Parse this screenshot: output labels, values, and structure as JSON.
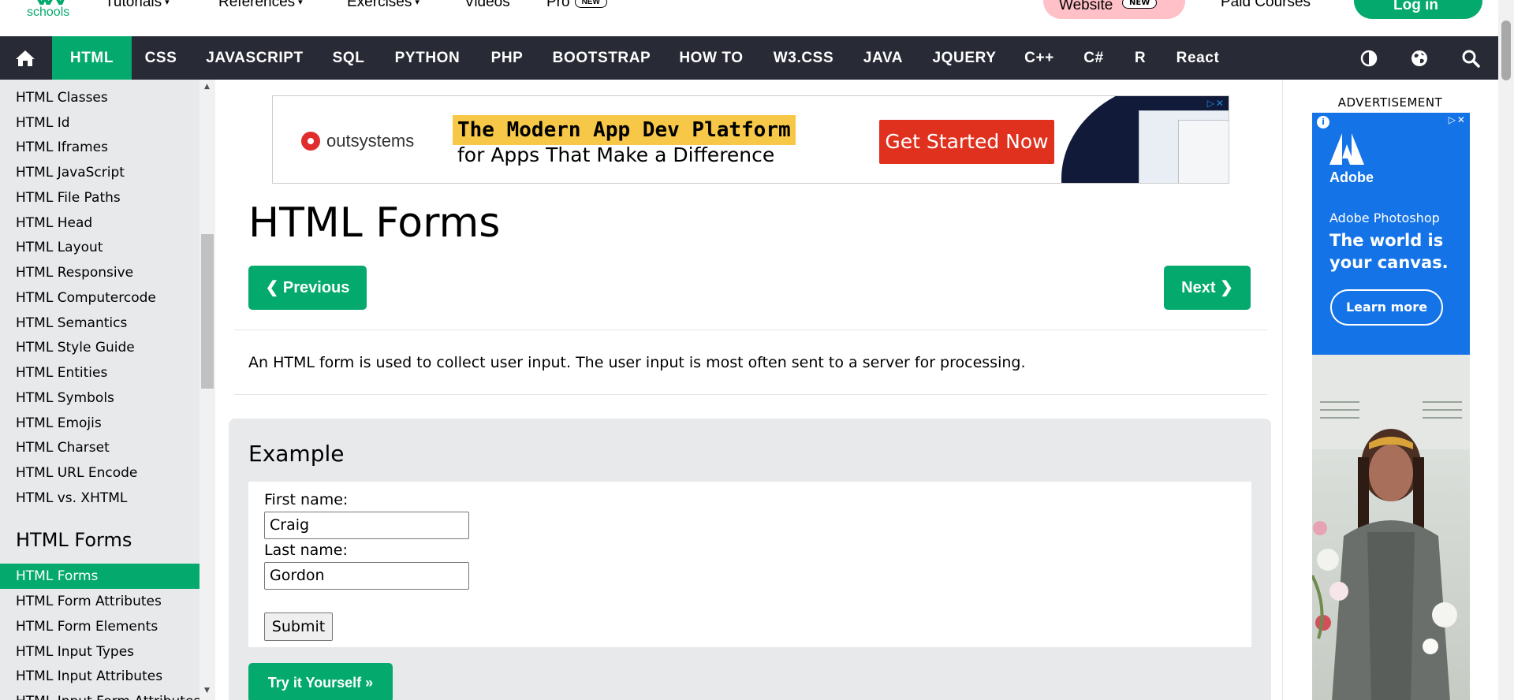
{
  "top_strip": {
    "logo_text": "schools",
    "menu": [
      {
        "label": "Tutorials"
      },
      {
        "label": "References"
      },
      {
        "label": "Exercises"
      },
      {
        "label": "Videos"
      },
      {
        "label": "Pro",
        "badge": "NEW"
      }
    ],
    "website_label": "Website",
    "website_badge": "NEW",
    "paid_courses": "Paid Courses",
    "login": "Log in"
  },
  "navbar": {
    "items": [
      "HTML",
      "CSS",
      "JAVASCRIPT",
      "SQL",
      "PYTHON",
      "PHP",
      "BOOTSTRAP",
      "HOW TO",
      "W3.CSS",
      "JAVA",
      "JQUERY",
      "C++",
      "C#",
      "R",
      "React"
    ],
    "active": "HTML",
    "icons": [
      "home-icon",
      "contrast-icon",
      "globe-icon",
      "search-icon"
    ]
  },
  "sidebar": {
    "items": [
      "HTML Classes",
      "HTML Id",
      "HTML Iframes",
      "HTML JavaScript",
      "HTML File Paths",
      "HTML Head",
      "HTML Layout",
      "HTML Responsive",
      "HTML Computercode",
      "HTML Semantics",
      "HTML Style Guide",
      "HTML Entities",
      "HTML Symbols",
      "HTML Emojis",
      "HTML Charset",
      "HTML URL Encode",
      "HTML vs. XHTML"
    ],
    "section_heading": "HTML Forms",
    "section_items": [
      "HTML Forms",
      "HTML Form Attributes",
      "HTML Form Elements",
      "HTML Input Types",
      "HTML Input Attributes",
      "HTML Input Form Attributes"
    ],
    "active": "HTML Forms"
  },
  "banner_ad": {
    "brand": "outsystems",
    "headline": "The Modern App Dev Platform",
    "subline": "for Apps That Make a Difference",
    "cta": "Get Started Now"
  },
  "main": {
    "title": "HTML Forms",
    "prev": "❮ Previous",
    "next": "Next ❯",
    "intro": "An HTML form is used to collect user input. The user input is most often sent to a server for processing.",
    "example": {
      "heading": "Example",
      "first_label": "First name:",
      "first_value": "Craig",
      "last_label": "Last name:",
      "last_value": "Gordon",
      "submit": "Submit",
      "try_it": "Try it Yourself »"
    }
  },
  "right_ad": {
    "label": "ADVERTISEMENT",
    "brand": "Adobe",
    "product": "Adobe Photoshop",
    "headline": "The world is your canvas.",
    "cta": "Learn more"
  },
  "colors": {
    "accent_green": "#04AA6D",
    "nav_dark": "#282A35",
    "sidebar_bg": "#E7E9EB",
    "adobe_blue": "#1473e6"
  }
}
